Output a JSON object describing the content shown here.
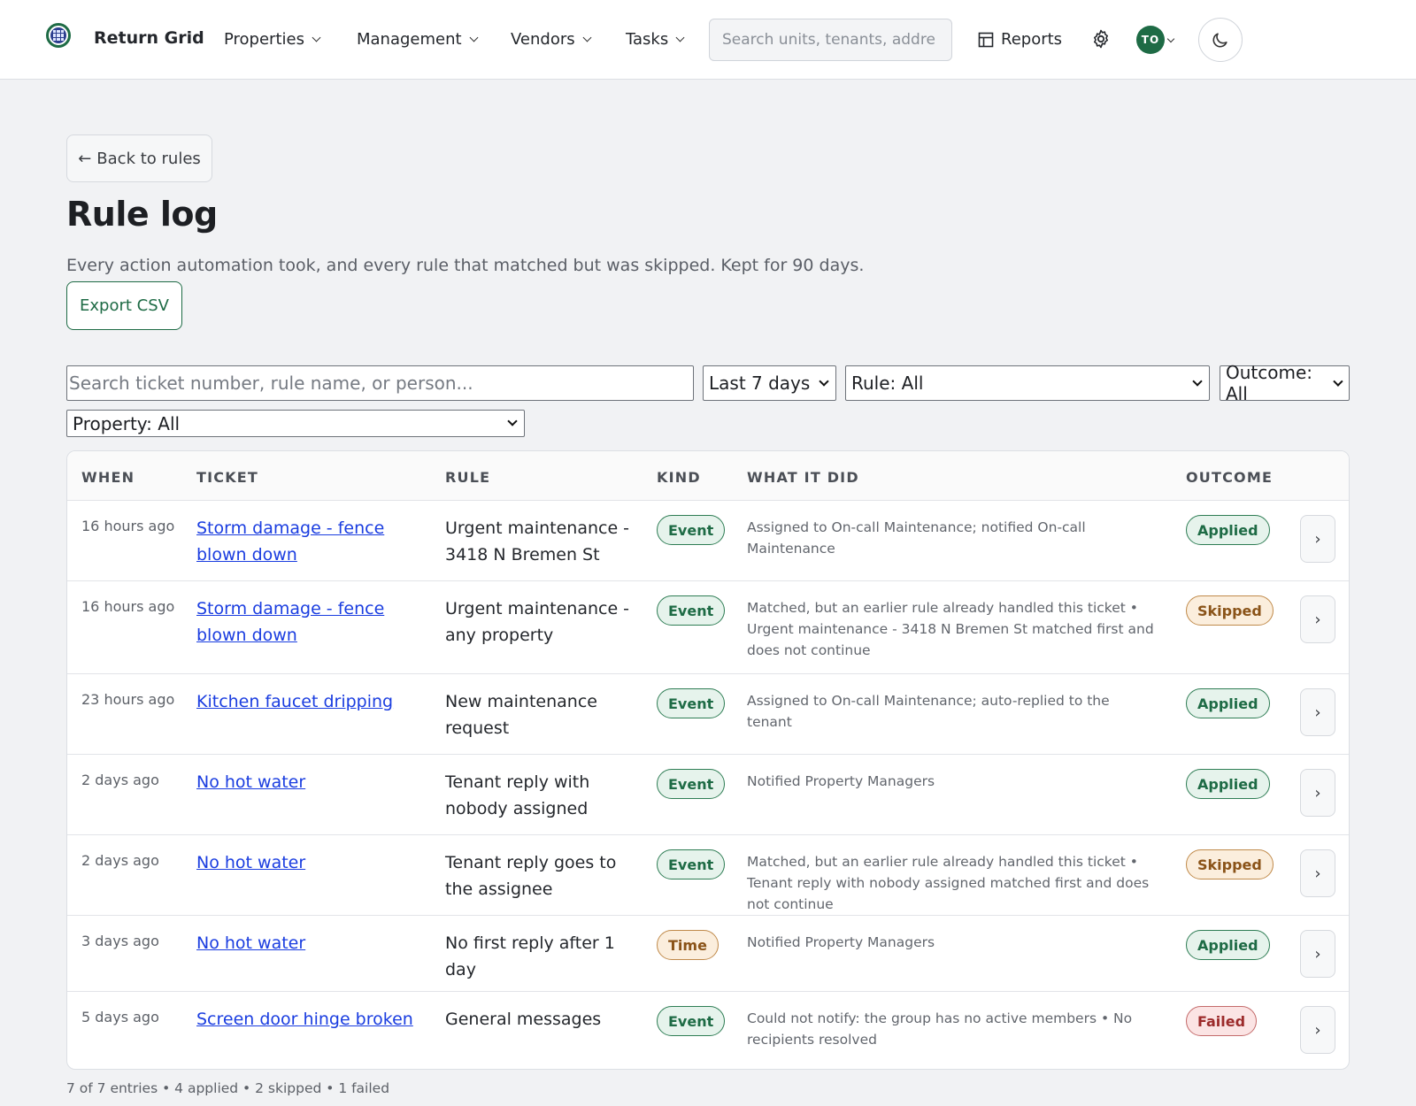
{
  "app": {
    "brand": "Return Grid",
    "nav": [
      "Properties",
      "Management",
      "Vendors",
      "Tasks"
    ],
    "search_placeholder": "Search units, tenants, addre",
    "reports_label": "Reports",
    "avatar_initials": "TO"
  },
  "page": {
    "back_label": "Back to rules",
    "title": "Rule log",
    "subtitle": "Every action automation took, and every rule that matched but was skipped. Kept for 90 days.",
    "export_label": "Export CSV"
  },
  "filters": {
    "search_placeholder": "Search ticket number, rule name, or person...",
    "range": "Last 7 days",
    "rule": "Rule: All",
    "outcome": "Outcome: All",
    "property": "Property: All"
  },
  "table": {
    "headers": [
      "WHEN",
      "TICKET",
      "RULE",
      "KIND",
      "WHAT IT DID",
      "OUTCOME"
    ],
    "rows": [
      {
        "when": "16 hours ago",
        "ticket": "Storm damage - fence blown down",
        "rule": "Urgent maintenance - 3418 N Bremen St",
        "kind": "Event",
        "did": "Assigned to On-call Maintenance; notified On-call Maintenance",
        "outcome": "Applied"
      },
      {
        "when": "16 hours ago",
        "ticket": "Storm damage - fence blown down",
        "rule": "Urgent maintenance - any property",
        "kind": "Event",
        "did": "Matched, but an earlier rule already handled this ticket • Urgent maintenance - 3418 N Bremen St matched first and does not continue",
        "outcome": "Skipped"
      },
      {
        "when": "23 hours ago",
        "ticket": "Kitchen faucet dripping",
        "rule": "New maintenance request",
        "kind": "Event",
        "did": "Assigned to On-call Maintenance; auto-replied to the tenant",
        "outcome": "Applied"
      },
      {
        "when": "2 days ago",
        "ticket": "No hot water",
        "rule": "Tenant reply with nobody assigned",
        "kind": "Event",
        "did": "Notified Property Managers",
        "outcome": "Applied"
      },
      {
        "when": "2 days ago",
        "ticket": "No hot water",
        "rule": "Tenant reply goes to the assignee",
        "kind": "Event",
        "did": "Matched, but an earlier rule already handled this ticket • Tenant reply with nobody assigned matched first and does not continue",
        "outcome": "Skipped"
      },
      {
        "when": "3 days ago",
        "ticket": "No hot water",
        "rule": "No first reply after 1 day",
        "kind": "Time",
        "did": "Notified Property Managers",
        "outcome": "Applied"
      },
      {
        "when": "5 days ago",
        "ticket": "Screen door hinge broken",
        "rule": "General messages",
        "kind": "Event",
        "did": "Could not notify: the group has no active members • No recipients resolved",
        "outcome": "Failed"
      }
    ]
  },
  "summary": "7 of 7 entries • 4 applied • 2 skipped • 1 failed",
  "colors": {
    "accent": "#1e6b45",
    "link": "#1a3de0",
    "applied": "#2e7d54",
    "skipped": "#c08a4a",
    "failed": "#c46b6b"
  }
}
